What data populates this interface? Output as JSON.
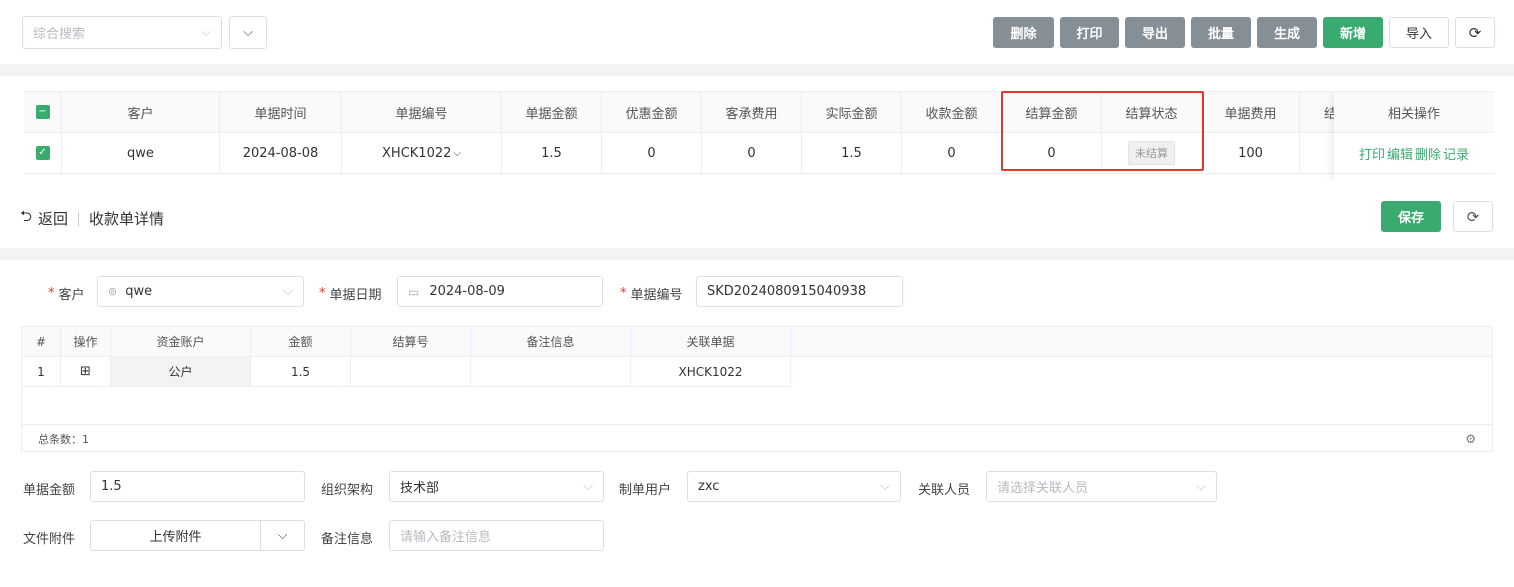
{
  "toolbar": {
    "search_placeholder": "综合搜索",
    "buttons": {
      "delete": "删除",
      "print": "打印",
      "export": "导出",
      "batch": "批量",
      "generate": "生成",
      "add": "新增",
      "import": "导入"
    }
  },
  "list_grid": {
    "columns": [
      "客户",
      "单据时间",
      "单据编号",
      "单据金额",
      "优惠金额",
      "客承费用",
      "实际金额",
      "收款金额",
      "结算金额",
      "结算状态",
      "单据费用",
      "结",
      "相关操作"
    ],
    "row": {
      "customer": "qwe",
      "date": "2024-08-08",
      "doc_no": "XHCK1022",
      "amount": "1.5",
      "discount": "0",
      "customer_fee": "0",
      "actual_amount": "1.5",
      "received_amount": "0",
      "settle_amount": "0",
      "settle_status": "未结算",
      "doc_fee": "100"
    },
    "actions": [
      "打印",
      "编辑",
      "删除",
      "记录"
    ]
  },
  "detail": {
    "back_label": "返回",
    "title": "收款单详情",
    "save_label": "保存",
    "customer_label": "客户",
    "customer_value": "qwe",
    "date_label": "单据日期",
    "date_value": "2024-08-09",
    "docno_label": "单据编号",
    "docno_value": "SKD2024080915040938"
  },
  "detail_grid": {
    "columns": [
      "#",
      "操作",
      "资金账户",
      "金额",
      "结算号",
      "备注信息",
      "关联单据"
    ],
    "row": {
      "index": "1",
      "account": "公户",
      "amount": "1.5",
      "settle_no": "",
      "remark": "",
      "related_doc": "XHCK1022"
    },
    "total_label": "总条数：1"
  },
  "bottom_form": {
    "amount_label": "单据金额",
    "amount_value": "1.5",
    "org_label": "组织架构",
    "org_value": "技术部",
    "creator_label": "制单用户",
    "creator_value": "zxc",
    "related_person_label": "关联人员",
    "related_person_placeholder": "请选择关联人员",
    "attachment_label": "文件附件",
    "upload_label": "上传附件",
    "remark_label": "备注信息",
    "remark_placeholder": "请输入备注信息"
  },
  "colors": {
    "primary": "#3aab6e",
    "gray_button": "#868e96",
    "highlight": "#e03a2e"
  },
  "icons": [
    "chevron-down-icon",
    "refresh-icon",
    "back-icon",
    "calendar-icon",
    "customer-icon",
    "plus-square-icon",
    "gear-icon",
    "checkbox-icon"
  ]
}
